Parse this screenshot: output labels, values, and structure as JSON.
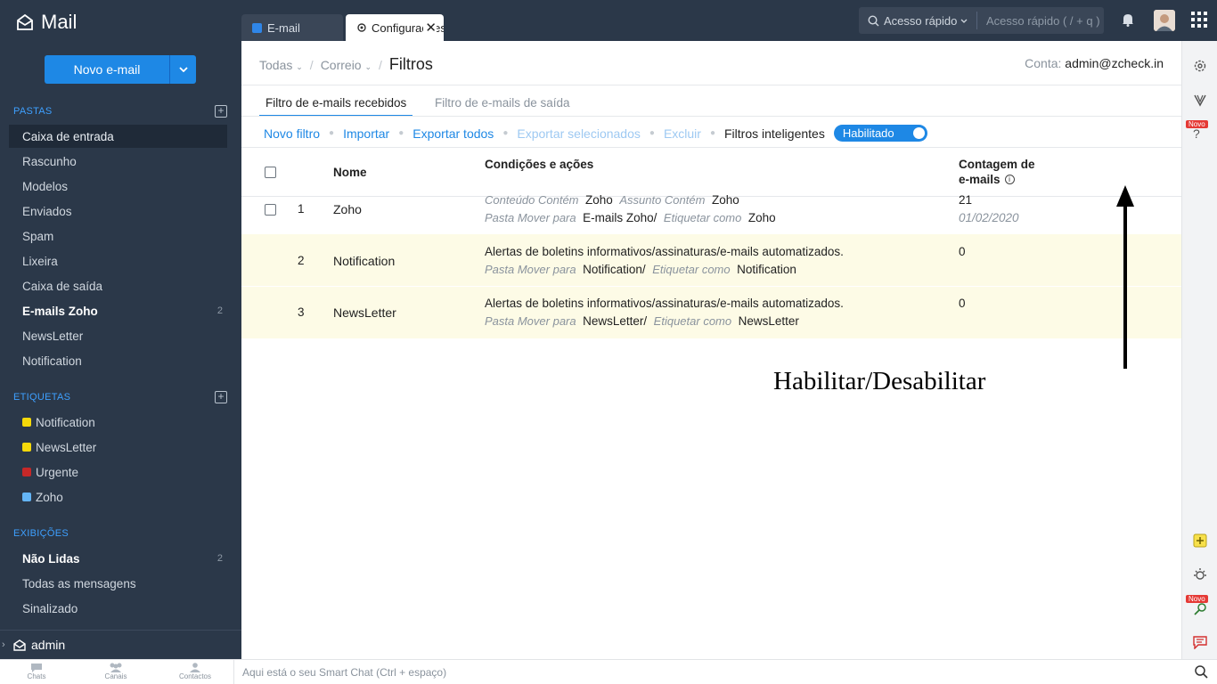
{
  "app": {
    "name": "Mail"
  },
  "sidebar": {
    "new_mail_label": "Novo e-mail",
    "folders_title": "PASTAS",
    "folders": [
      {
        "label": "Caixa de entrada",
        "count": ""
      },
      {
        "label": "Rascunho",
        "count": ""
      },
      {
        "label": "Modelos",
        "count": ""
      },
      {
        "label": "Enviados",
        "count": ""
      },
      {
        "label": "Spam",
        "count": ""
      },
      {
        "label": "Lixeira",
        "count": ""
      },
      {
        "label": "Caixa de saída",
        "count": ""
      },
      {
        "label": "E-mails Zoho",
        "count": "2"
      },
      {
        "label": "NewsLetter",
        "count": ""
      },
      {
        "label": "Notification",
        "count": ""
      }
    ],
    "tags_title": "ETIQUETAS",
    "tags": [
      {
        "label": "Notification",
        "color": "#f5d90a"
      },
      {
        "label": "NewsLetter",
        "color": "#f5d90a"
      },
      {
        "label": "Urgente",
        "color": "#c62828"
      },
      {
        "label": "Zoho",
        "color": "#64b5f6"
      }
    ],
    "views_title": "EXIBIÇÕES",
    "views": [
      {
        "label": "Não Lidas",
        "count": "2"
      },
      {
        "label": "Todas as mensagens",
        "count": ""
      },
      {
        "label": "Sinalizado",
        "count": ""
      }
    ],
    "user": "admin"
  },
  "topbar": {
    "tabs": [
      {
        "label": "E-mail"
      },
      {
        "label": "Configurações"
      }
    ],
    "quick_access_label": "Acesso rápido",
    "quick_access_placeholder": "Acesso rápido  ( / + q )"
  },
  "main": {
    "breadcrumb": {
      "all": "Todas",
      "mail": "Correio",
      "current": "Filtros"
    },
    "account_label": "Conta:",
    "account_value": "admin@zcheck.in",
    "subtabs": [
      "Filtro de e-mails recebidos",
      "Filtro de e-mails de saída"
    ],
    "toolbar": {
      "new_filter": "Novo filtro",
      "import": "Importar",
      "export_all": "Exportar todos",
      "export_selected": "Exportar selecionados",
      "delete": "Excluir",
      "smart_filters": "Filtros inteligentes",
      "toggle_label": "Habilitado"
    },
    "table": {
      "headers": {
        "name": "Nome",
        "conditions": "Condições e ações",
        "count_line1": "Contagem de",
        "count_line2": "e-mails"
      },
      "rows": [
        {
          "num": "1",
          "name": "Zoho",
          "c1": "Conteúdo Contém",
          "v1": "Zoho",
          "c2": "Assunto Contém",
          "v2": "Zoho",
          "a1": "Pasta Mover para",
          "av1": "E-mails Zoho/",
          "a2": "Etiquetar como",
          "av2": "Zoho",
          "count": "21",
          "date": "01/02/2020"
        },
        {
          "num": "2",
          "name": "Notification",
          "desc": "Alertas de boletins informativos/assinaturas/e-mails automatizados.",
          "a1": "Pasta Mover para",
          "av1": "Notification/",
          "a2": "Etiquetar como",
          "av2": "Notification",
          "count": "0"
        },
        {
          "num": "3",
          "name": "NewsLetter",
          "desc": "Alertas de boletins informativos/assinaturas/e-mails automatizados.",
          "a1": "Pasta Mover para",
          "av1": "NewsLetter/",
          "a2": "Etiquetar como",
          "av2": "NewsLetter",
          "count": "0"
        }
      ]
    },
    "annotation": "Habilitar/Desabilitar"
  },
  "rail": {
    "new_badge": "Novo"
  },
  "bottombar": {
    "nav": [
      "Chats",
      "Canais",
      "Contactos"
    ],
    "smart_chat_placeholder": "Aqui está o seu Smart Chat (Ctrl + espaço)"
  }
}
